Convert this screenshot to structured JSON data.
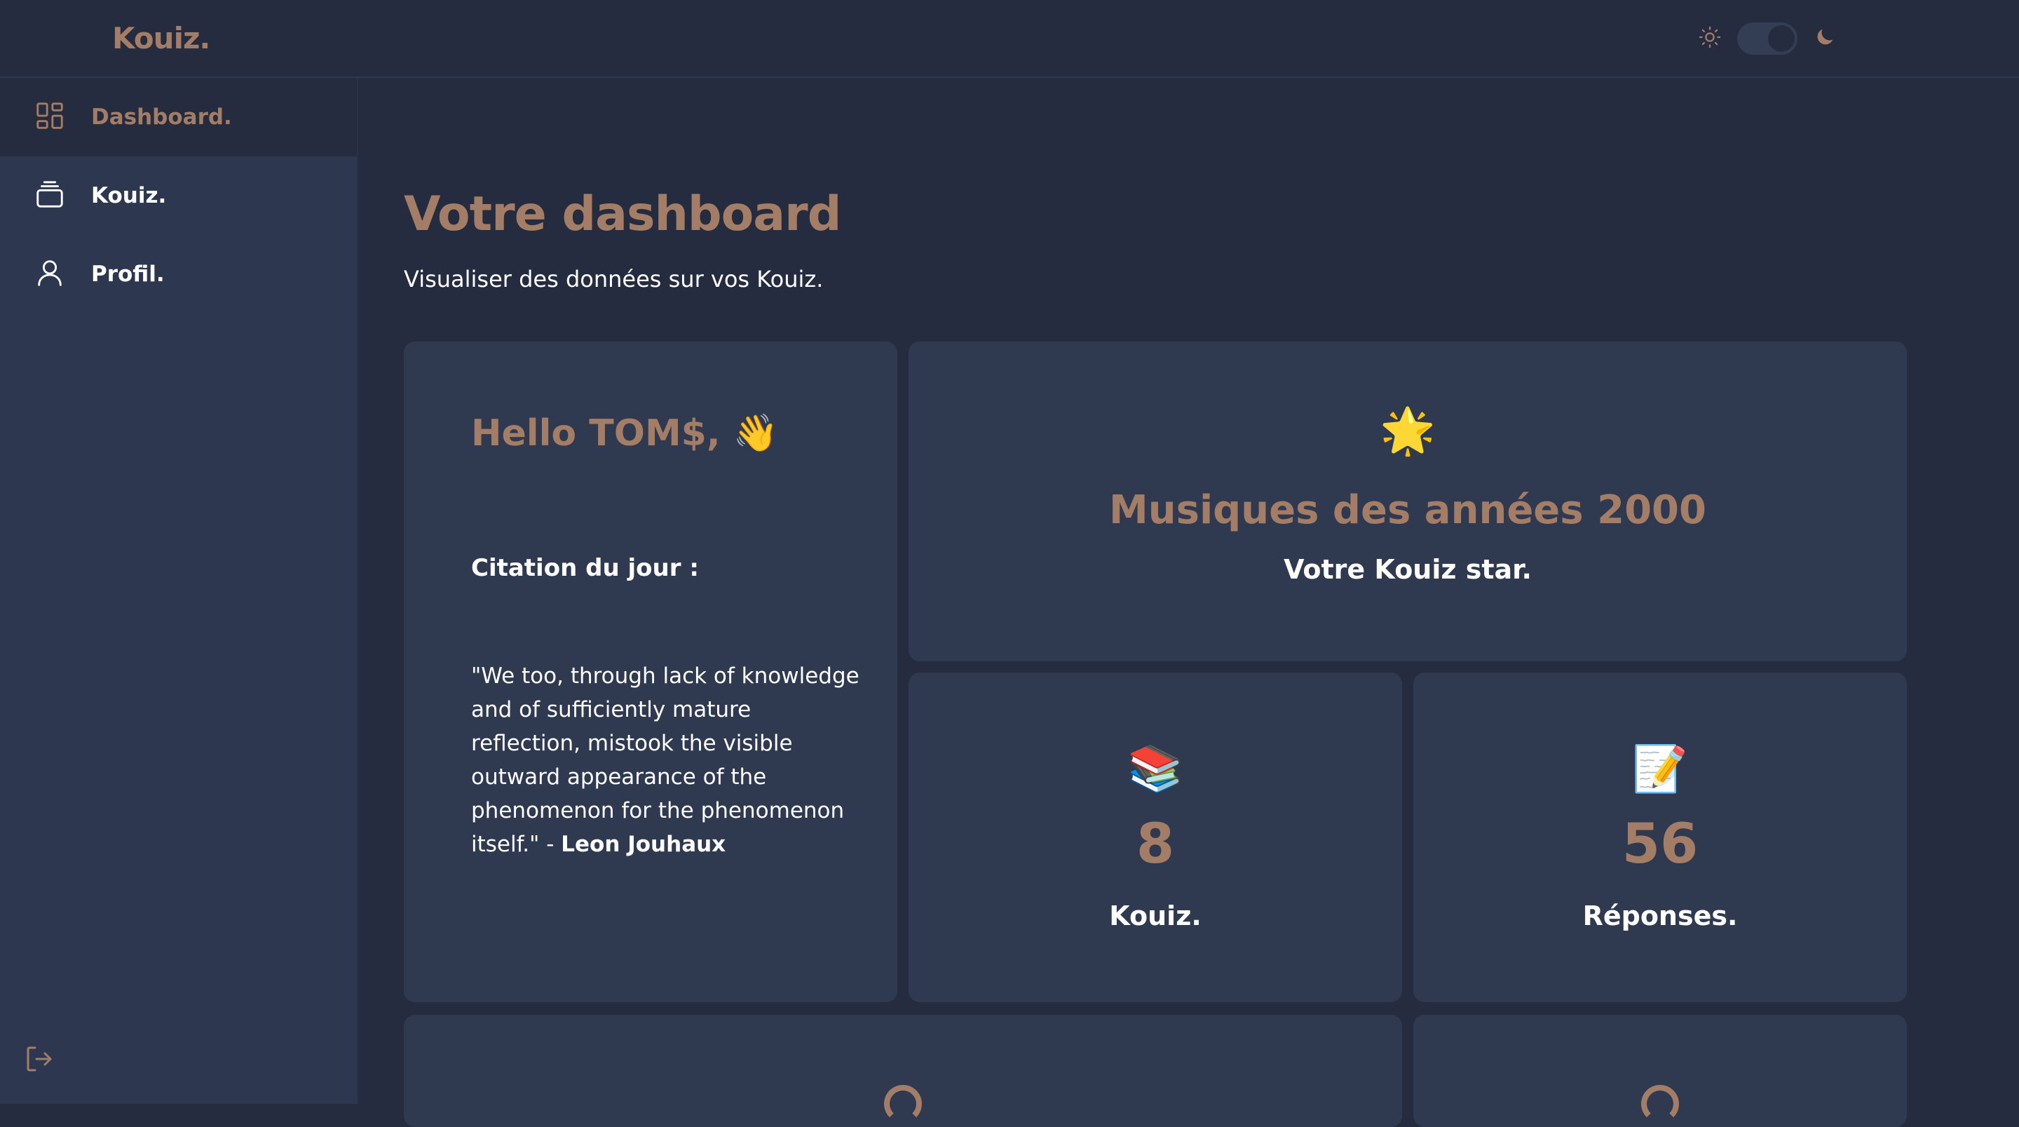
{
  "header": {
    "logo": "Kouiz.",
    "theme_toggle": {
      "light_icon": "sun-icon",
      "dark_icon": "moon-icon",
      "mode": "dark"
    }
  },
  "sidebar": {
    "items": [
      {
        "label": "Dashboard.",
        "icon": "dashboard-grid-icon",
        "active": true
      },
      {
        "label": "Kouiz.",
        "icon": "stack-icon",
        "active": false
      },
      {
        "label": "Profil.",
        "icon": "user-icon",
        "active": false
      }
    ],
    "logout_icon": "logout-icon"
  },
  "main": {
    "title": "Votre dashboard",
    "subtitle": "Visualiser des données sur vos Kouiz."
  },
  "greeting_card": {
    "hello": "Hello TOM$, 👋",
    "citation_label": "Citation du jour :",
    "quote": "\"We too, through lack of knowledge and of sufficiently mature reflection, mistook the visible outward appearance of the phenomenon for the phenomenon itself.\" - ",
    "author": "Leon Jouhaux"
  },
  "star_card": {
    "emoji": "🌟",
    "title": "Musiques des années 2000",
    "subtitle": "Votre Kouiz star."
  },
  "stats": [
    {
      "emoji": "📚",
      "value": "8",
      "label": "Kouiz."
    },
    {
      "emoji": "📝",
      "value": "56",
      "label": "Réponses."
    }
  ],
  "colors": {
    "accent": "#a37d65",
    "background": "#252c3f",
    "card": "#2f3a51",
    "sidebar": "#2d3850"
  }
}
